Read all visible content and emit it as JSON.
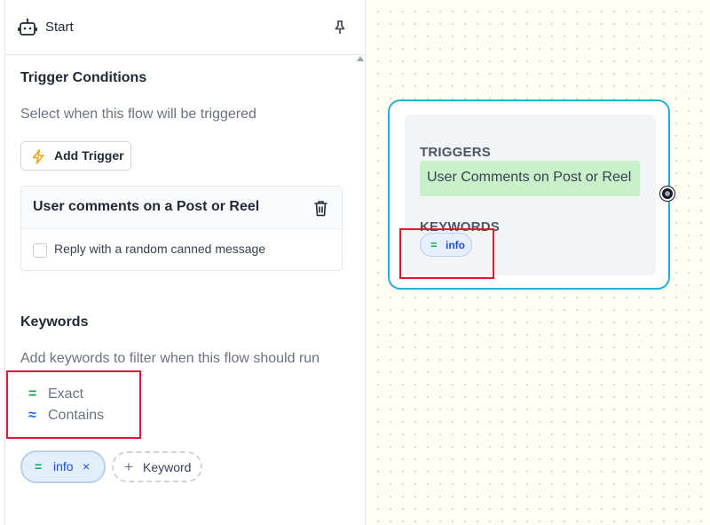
{
  "panel": {
    "title": "Start",
    "icons": {
      "node_type": "bot-icon",
      "pin": "pin-icon"
    }
  },
  "trigger_section": {
    "title": "Trigger Conditions",
    "description": "Select when this flow will be triggered",
    "add_button": "Add Trigger",
    "card": {
      "title": "User comments on a Post or Reel",
      "option_label": "Reply with a random canned message",
      "option_checked": false
    }
  },
  "keywords_section": {
    "title": "Keywords",
    "description": "Add keywords to filter when this flow should run",
    "match_types": [
      {
        "symbol": "=",
        "label": "Exact"
      },
      {
        "symbol": "≈",
        "label": "Contains"
      }
    ],
    "chips": [
      {
        "symbol": "=",
        "text": "info",
        "remove": "×"
      }
    ],
    "add_button": "Keyword",
    "add_symbol": "+"
  },
  "node": {
    "triggers_label": "TRIGGERS",
    "trigger_text": "User Comments on Post or Reel",
    "keywords_label": "KEYWORDS",
    "keyword_chip": {
      "symbol": "=",
      "text": "info"
    }
  },
  "colors": {
    "accent_node_border": "#22b1d4",
    "trigger_bg": "#c9f0c9",
    "chip_bg": "#e3eefb",
    "highlight_red": "#e0182f",
    "exact_green": "#16a34a",
    "contains_blue": "#2563eb"
  }
}
